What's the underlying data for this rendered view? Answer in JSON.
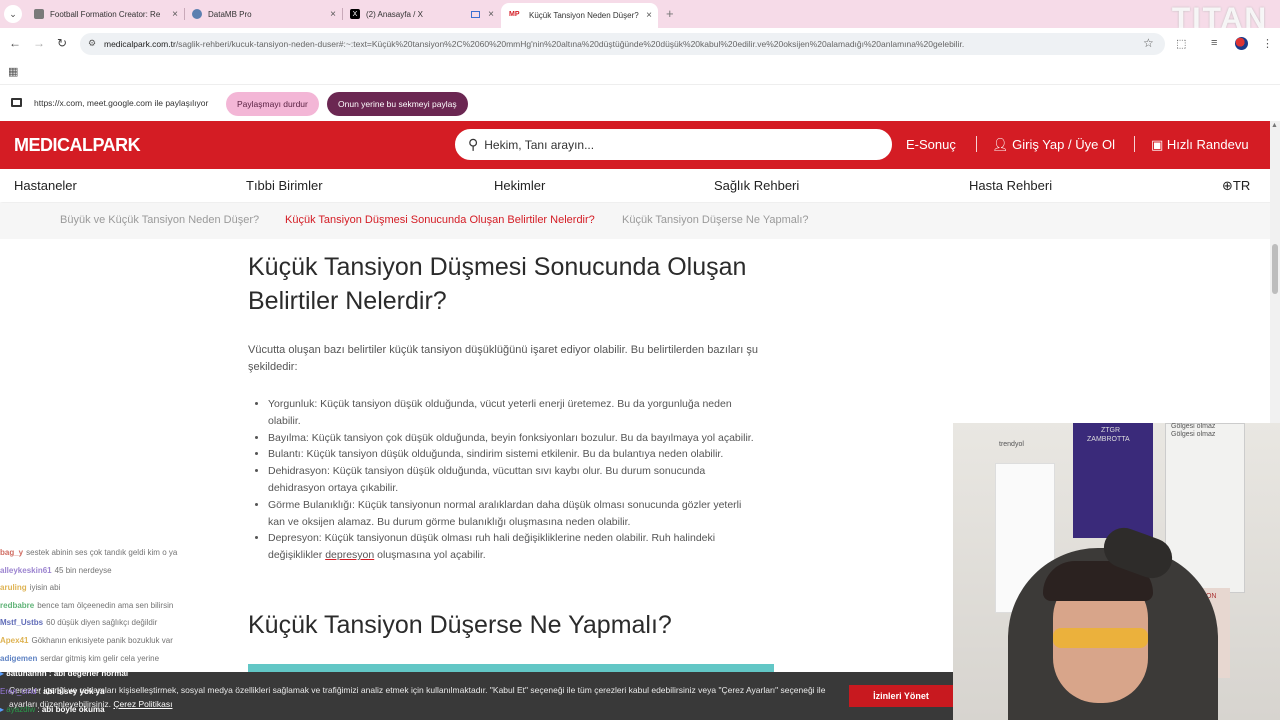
{
  "browser": {
    "tabs": [
      {
        "title": "Football Formation Creator: Re",
        "icon_color": "#7a7a7a"
      },
      {
        "title": "DataMB Pro",
        "icon_color": "#5b7fb0"
      },
      {
        "title": "(2) Anasayfa / X",
        "icon_color": "#000000"
      },
      {
        "title": "Küçük Tansiyon Neden Düşer? K",
        "icon_color": "#d41c24",
        "favicon_text": "MP"
      }
    ],
    "url_domain": "medicalpark.com.tr",
    "url_path": "/saglik-rehberi/kucuk-tansiyon-neden-duser#:~:text=Küçük%20tansiyon%2C%2060%20mmHg'nin%20altına%20düştüğünde%20düşük%20kabul%20edilir.ve%20oksijen%20alamadığı%20anlamına%20gelebilir.",
    "watermark": "TITAN"
  },
  "sharebar": {
    "text": "https://x.com, meet.google.com ile paylaşılıyor",
    "stop_label": "Paylaşmayı durdur",
    "share_tab_label": "Onun yerine bu sekmeyi paylaş"
  },
  "header": {
    "logo": "MEDICALPARK",
    "search_placeholder": "Hekim, Tanı arayın...",
    "esonuc": "E-Sonuç",
    "login": "Giriş Yap / Üye Ol",
    "appointment": "Hızlı Randevu"
  },
  "nav": {
    "items": [
      "Hastaneler",
      "Tıbbi Birimler",
      "Hekimler",
      "Sağlık Rehberi",
      "Hasta Rehberi"
    ],
    "lang": "TR"
  },
  "anchors": [
    "Büyük ve Küçük Tansiyon Neden Düşer?",
    "Küçük Tansiyon Düşmesi Sonucunda Oluşan Belirtiler Nelerdir?",
    "Küçük Tansiyon Düşerse Ne Yapmalı?"
  ],
  "article": {
    "heading1_line1": "Küçük Tansiyon Düşmesi Sonucunda Oluşan",
    "heading1_line2": "Belirtiler Nelerdir?",
    "intro": "Vücutta oluşan bazı belirtiler küçük tansiyon düşüklüğünü işaret ediyor olabilir. Bu belirtilerden bazıları şu şekildedir:",
    "symptoms": [
      "Yorgunluk: Küçük tansiyon düşük olduğunda, vücut yeterli enerji üretemez. Bu da yorgunluğa neden olabilir.",
      "Bayılma: Küçük tansiyon çok düşük olduğunda, beyin fonksiyonları bozulur. Bu da bayılmaya yol açabilir.",
      "Bulantı: Küçük tansiyon düşük olduğunda, sindirim sistemi etkilenir. Bu da bulantıya neden olabilir.",
      "Dehidrasyon: Küçük tansiyon düşük olduğunda, vücuttan sıvı kaybı olur. Bu durum sonucunda dehidrasyon ortaya çıkabilir.",
      "Görme Bulanıklığı: Küçük tansiyonun normal aralıklardan daha düşük olması sonucunda gözler yeterli kan ve oksijen alamaz. Bu durum görme bulanıklığı oluşmasına neden olabilir."
    ],
    "last_symptom_before": "Depresyon: Küçük tansiyonun düşük olması ruh hali değişikliklerine neden olabilir. Ruh halindeki değişiklikler ",
    "last_symptom_link": "depresyon",
    "last_symptom_after": " oluşmasına yol açabilir.",
    "heading2": "Küçük Tansiyon Düşerse Ne Yapmalı?"
  },
  "chat": [
    {
      "user": "bag_y",
      "msg": "sestek abinin ses çok tandık geldi kim o ya",
      "color": "#c0392b"
    },
    {
      "user": "alleykeskin61",
      "msg": "45 bin nerdeyse",
      "color": "#7a5ac0"
    },
    {
      "user": "aruling",
      "msg": "iyisin abi",
      "color": "#d49a1a"
    },
    {
      "user": "redbabre",
      "msg": "bence tam ölçeenedin ama sen bilirsin",
      "color": "#2a9a4a"
    },
    {
      "user": "Mstf_Ustbs",
      "msg": "60 düşük diyen sağlıkçı değildir",
      "color": "#2a3aa0"
    },
    {
      "user": "Apex41",
      "msg": "Gökhanın enkısiyete panik bozukluk var",
      "color": "#d49a1a"
    },
    {
      "user": "adigemen",
      "msg": "serdar gitmiş kim gelir cela yerine",
      "color": "#2a5ab0"
    },
    {
      "user": "8atuhannn",
      "msg": "abi değerler normal",
      "color": "#ffffff"
    },
    {
      "user": "Eren_cmd",
      "msg": "abi bisey yok ya",
      "color": "#9a7adf"
    },
    {
      "user": "ayazdiw",
      "msg": "abi böyle okuma",
      "color": "#2a9a4a"
    }
  ],
  "cookie": {
    "text": "Çerezler içeriği ve reklamları kişiselleştirmek, sosyal medya özellikleri sağlamak ve trafiğimizi analiz etmek için kullanılmaktadır. \"Kabul Et\" seçeneği ile tüm çerezleri kabul edebilirsiniz veya \"Çerez Ayarları\" seçeneği ile ayarları düzenleyebilirsiniz.",
    "policy_link": "Çerez Politikası",
    "button": "İzinleri Yönet"
  },
  "webcam": {
    "labels": [
      "trendyol",
      "ZTGR",
      "ZAMBROTTA",
      "TRABZON",
      "Gölgesi olmaz",
      "Gölgesi olmaz"
    ]
  },
  "colors": {
    "brand_red": "#d41c24",
    "tab_strip": "#f6dbe8",
    "share_stop": "#f3b6d6",
    "share_tab": "#6b2752",
    "teal": "#62c7c6"
  }
}
